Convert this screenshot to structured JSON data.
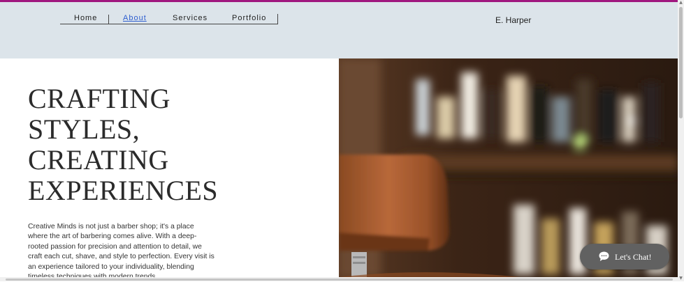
{
  "nav": {
    "items": [
      {
        "label": "Home"
      },
      {
        "label": "About"
      },
      {
        "label": "Services"
      },
      {
        "label": "Portfolio"
      }
    ],
    "active": "About"
  },
  "brand": "E. Harper",
  "hero": {
    "title_lines": [
      "CRAFTING",
      "STYLES,",
      "CREATING",
      "EXPERIENCES"
    ],
    "body": "Creative Minds is not just a barber shop; it's a place where the art of barbering comes alive. With a deep-rooted passion for precision and attention to detail, we craft each cut, shave, and style to perfection. Every visit is an experience tailored to your individuality, blending timeless techniques with modern trends."
  },
  "chat": {
    "label": "Let's Chat!",
    "icon": "chat-bubble-icon"
  },
  "colors": {
    "accent_line": "#a0177f",
    "header_bg": "#dce4ea",
    "active_link": "#2f5fd0",
    "chat_bg": "#616161"
  }
}
